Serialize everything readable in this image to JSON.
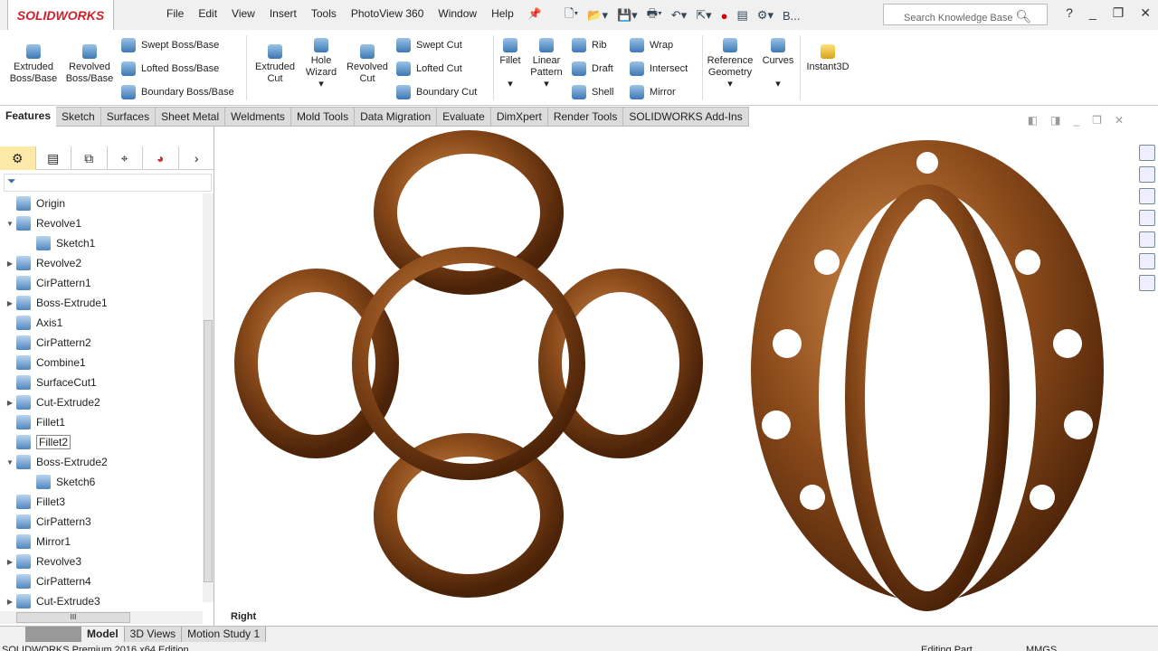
{
  "app": {
    "logo": "SOLIDWORKS"
  },
  "menu": [
    "File",
    "Edit",
    "View",
    "Insert",
    "Tools",
    "PhotoView 360",
    "Window",
    "Help"
  ],
  "quick": {
    "overflow": "B...",
    "help": "?"
  },
  "search": {
    "placeholder": "Search Knowledge Base"
  },
  "ribbon": {
    "extruded_boss": "Extruded Boss/Base",
    "revolved_boss": "Revolved Boss/Base",
    "swept_boss": "Swept Boss/Base",
    "lofted_boss": "Lofted Boss/Base",
    "boundary_boss": "Boundary Boss/Base",
    "extruded_cut": "Extruded Cut",
    "hole_wizard": "Hole Wizard",
    "revolved_cut": "Revolved Cut",
    "swept_cut": "Swept Cut",
    "lofted_cut": "Lofted Cut",
    "boundary_cut": "Boundary Cut",
    "fillet": "Fillet",
    "linear_pattern": "Linear Pattern",
    "rib": "Rib",
    "draft": "Draft",
    "shell": "Shell",
    "wrap": "Wrap",
    "intersect": "Intersect",
    "mirror": "Mirror",
    "reference_geometry": "Reference Geometry",
    "curves": "Curves",
    "instant3d": "Instant3D"
  },
  "tabs": [
    "Features",
    "Sketch",
    "Surfaces",
    "Sheet Metal",
    "Weldments",
    "Mold Tools",
    "Data Migration",
    "Evaluate",
    "DimXpert",
    "Render Tools",
    "SOLIDWORKS Add-Ins"
  ],
  "tree": [
    {
      "label": "Origin",
      "exp": "",
      "sub": false
    },
    {
      "label": "Revolve1",
      "exp": "▼",
      "sub": false
    },
    {
      "label": "Sketch1",
      "exp": "",
      "sub": true
    },
    {
      "label": "Revolve2",
      "exp": "▶",
      "sub": false
    },
    {
      "label": "CirPattern1",
      "exp": "",
      "sub": false
    },
    {
      "label": "Boss-Extrude1",
      "exp": "▶",
      "sub": false
    },
    {
      "label": "Axis1",
      "exp": "",
      "sub": false
    },
    {
      "label": "CirPattern2",
      "exp": "",
      "sub": false
    },
    {
      "label": "Combine1",
      "exp": "",
      "sub": false
    },
    {
      "label": "SurfaceCut1",
      "exp": "",
      "sub": false
    },
    {
      "label": "Cut-Extrude2",
      "exp": "▶",
      "sub": false
    },
    {
      "label": "Fillet1",
      "exp": "",
      "sub": false
    },
    {
      "label": "Fillet2",
      "exp": "",
      "sub": false,
      "selected": true
    },
    {
      "label": "Boss-Extrude2",
      "exp": "▼",
      "sub": false
    },
    {
      "label": "Sketch6",
      "exp": "",
      "sub": true
    },
    {
      "label": "Fillet3",
      "exp": "",
      "sub": false
    },
    {
      "label": "CirPattern3",
      "exp": "",
      "sub": false
    },
    {
      "label": "Mirror1",
      "exp": "",
      "sub": false
    },
    {
      "label": "Revolve3",
      "exp": "▶",
      "sub": false
    },
    {
      "label": "CirPattern4",
      "exp": "",
      "sub": false
    },
    {
      "label": "Cut-Extrude3",
      "exp": "▶",
      "sub": false
    }
  ],
  "viewport": {
    "view_label": "Right"
  },
  "bottom_tabs": [
    "Model",
    "3D Views",
    "Motion Study 1"
  ],
  "status": {
    "edition": "SOLIDWORKS Premium 2016 x64 Edition",
    "mode": "Editing Part",
    "units": "MMGS"
  },
  "colors": {
    "bronze": "#8a4a1a",
    "accent": "#d0202a"
  }
}
